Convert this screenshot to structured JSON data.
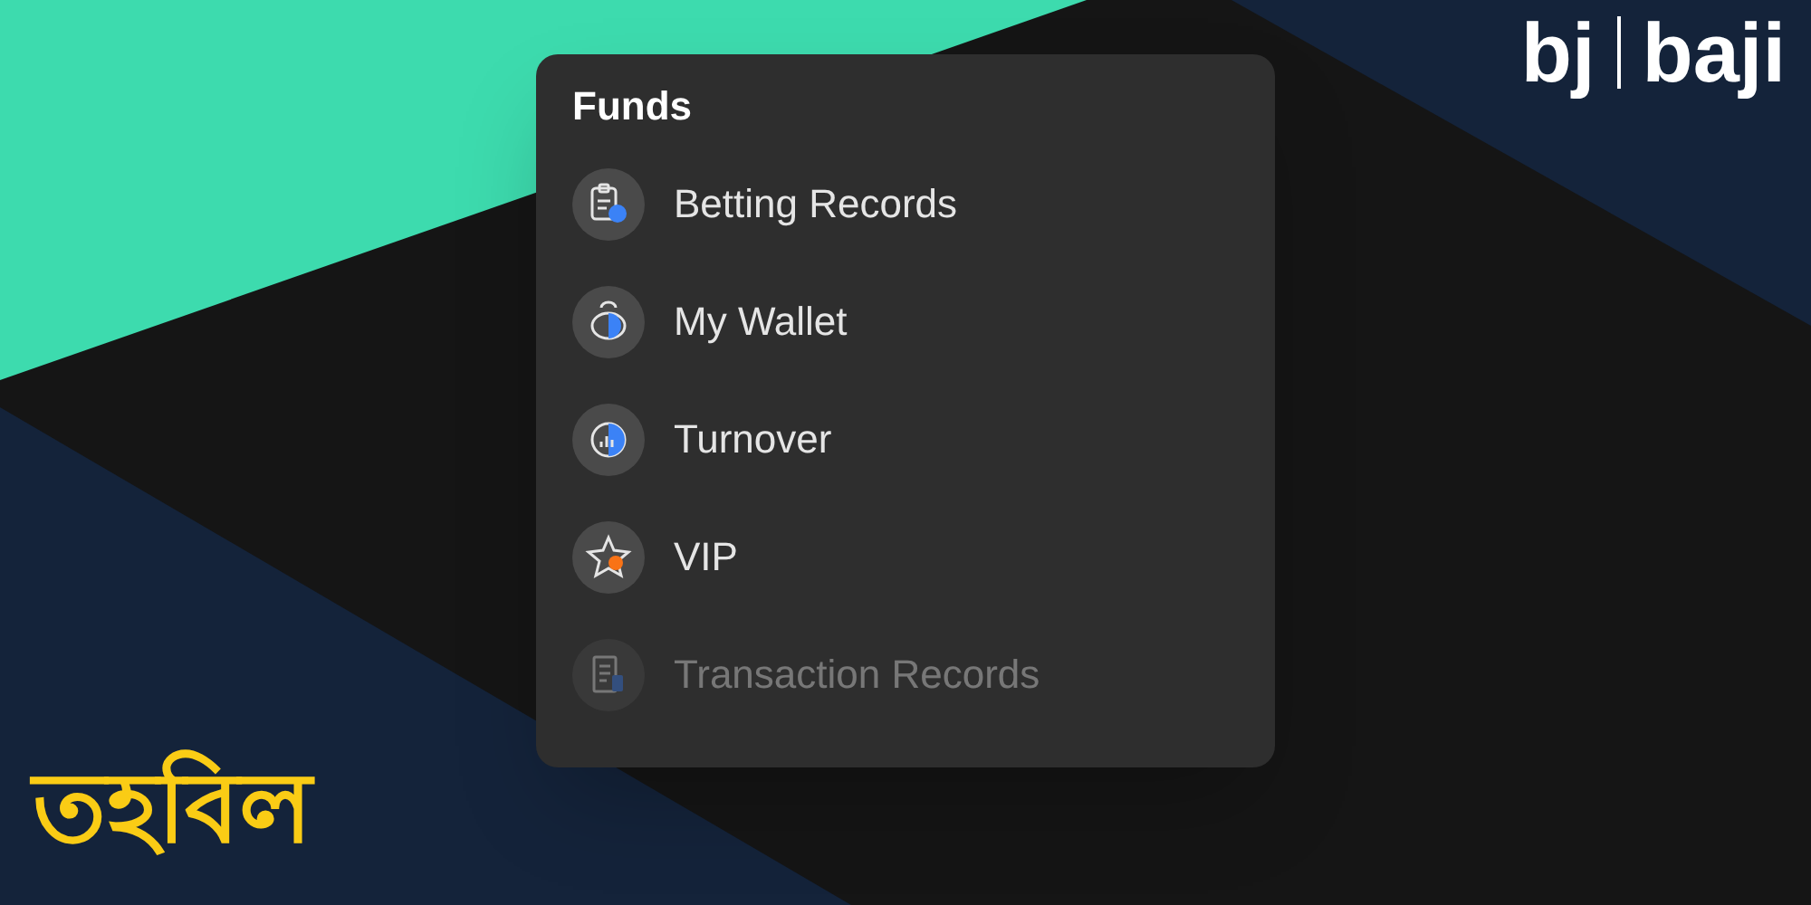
{
  "logo": {
    "short": "bj",
    "name": "baji"
  },
  "menu": {
    "title": "Funds",
    "items": [
      {
        "label": "Betting Records",
        "kind": "records",
        "dimmed": false
      },
      {
        "label": "My Wallet",
        "kind": "wallet",
        "dimmed": false
      },
      {
        "label": "Turnover",
        "kind": "turnover",
        "dimmed": false
      },
      {
        "label": "VIP",
        "kind": "vip",
        "dimmed": false
      },
      {
        "label": "Transaction Records",
        "kind": "transactions",
        "dimmed": true
      }
    ]
  },
  "heading": "তহবিল"
}
